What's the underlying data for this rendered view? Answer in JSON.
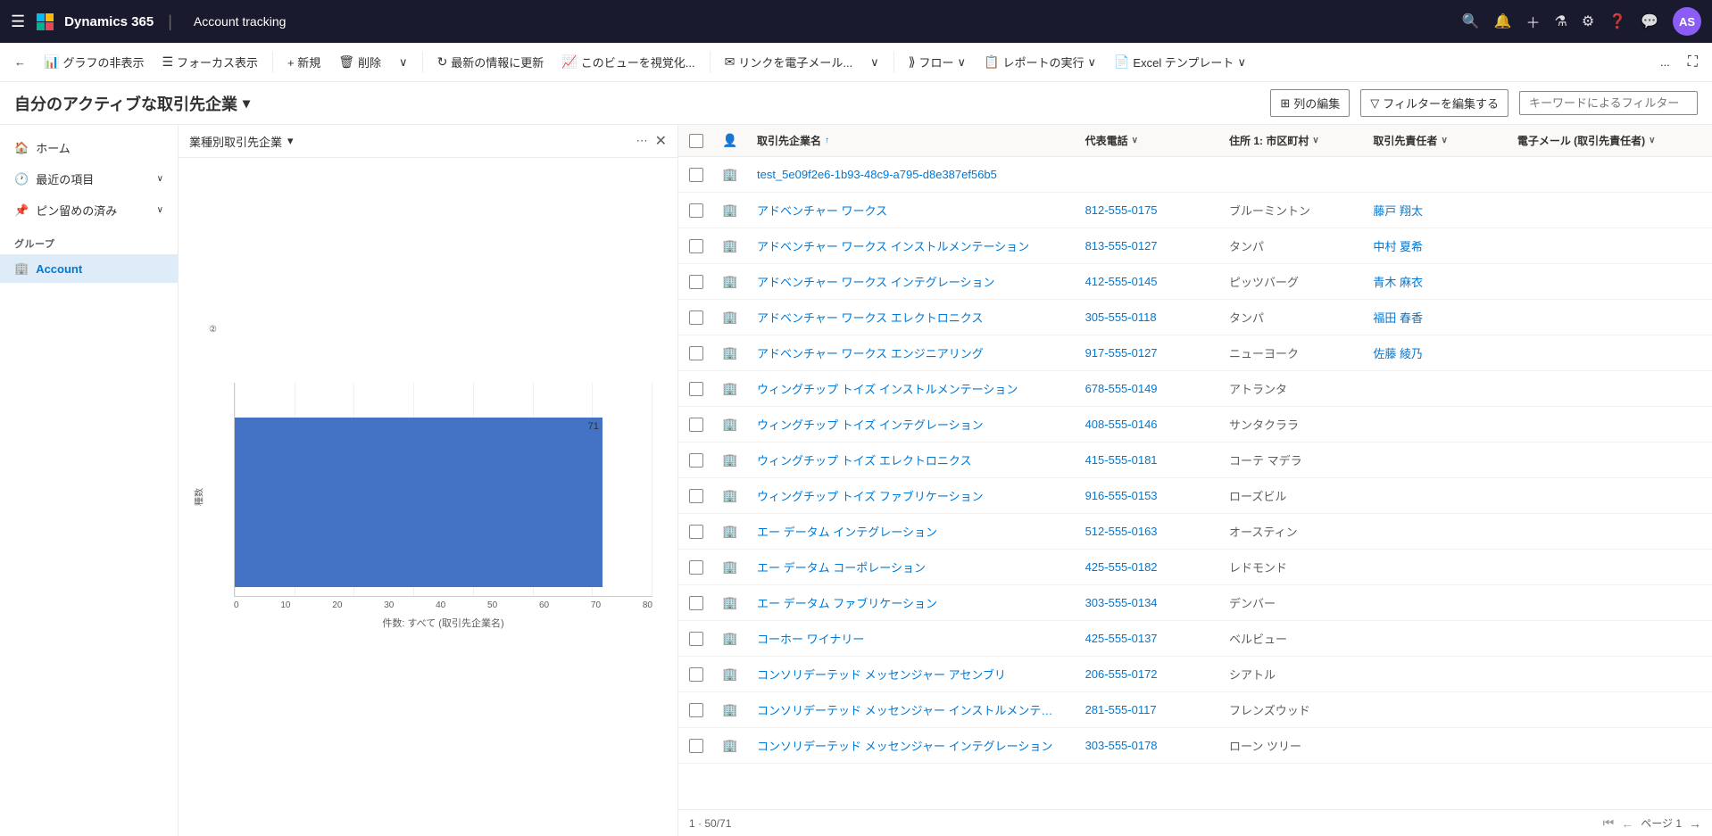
{
  "app": {
    "brand": "Dynamics 365",
    "page_title": "Account tracking"
  },
  "topnav": {
    "icons": [
      "grid-icon",
      "search-icon",
      "alert-icon",
      "plus-icon",
      "filter-icon",
      "settings-icon",
      "help-icon",
      "chat-icon"
    ],
    "avatar_text": "AS"
  },
  "command_bar": {
    "back_label": "←",
    "hide_chart": "グラフの非表示",
    "focus_view": "フォーカス表示",
    "new_label": "+ 新規",
    "delete_label": "削除",
    "refresh_label": "最新の情報に更新",
    "visualize_label": "このビューを視覚化...",
    "email_link": "リンクを電子メール...",
    "flow_label": "フロー",
    "report_label": "レポートの実行",
    "excel_label": "Excel テンプレート",
    "more_label": "..."
  },
  "page_header": {
    "title": "自分のアクティブな取引先企業",
    "dropdown_icon": "▾",
    "edit_columns": "列の編集",
    "edit_filter": "フィルターを編集する",
    "keyword_placeholder": "キーワードによるフィルター"
  },
  "sidebar": {
    "hamburger": "☰",
    "items": [
      {
        "label": "ホーム",
        "icon": "🏠",
        "active": false
      },
      {
        "label": "最近の項目",
        "icon": "🕐",
        "active": false,
        "expand": true
      },
      {
        "label": "ピン留めの済み",
        "icon": "📌",
        "active": false,
        "expand": true
      }
    ],
    "group_label": "グループ",
    "account_label": "Account",
    "account_active": true
  },
  "chart": {
    "title": "業種別取引先企業",
    "dropdown_icon": "▾",
    "bar_value": "71",
    "bar_value_left": "②",
    "x_labels": [
      "0",
      "10",
      "20",
      "30",
      "40",
      "50",
      "60",
      "70",
      "80"
    ],
    "y_label": "種数",
    "x_axis_title": "件数: すべて (取引先企業名)"
  },
  "grid": {
    "columns": [
      {
        "label": "",
        "type": "checkbox"
      },
      {
        "label": "",
        "type": "icon"
      },
      {
        "label": "取引先企業名",
        "sort": "↑",
        "sorted": true
      },
      {
        "label": "代表電話",
        "sort": "∨"
      },
      {
        "label": "住所 1: 市区町村",
        "sort": "∨"
      },
      {
        "label": "取引先責任者",
        "sort": "∨"
      },
      {
        "label": "電子メール (取引先責任者)",
        "sort": "∨"
      }
    ],
    "rows": [
      {
        "name": "test_5e09f2e6-1b93-48c9-a795-d8e387ef56b5",
        "phone": "",
        "city": "",
        "owner": "",
        "email": ""
      },
      {
        "name": "アドベンチャー ワークス",
        "phone": "812-555-0175",
        "city": "ブルーミントン",
        "owner": "藤戸 翔太",
        "email": ""
      },
      {
        "name": "アドベンチャー ワークス インストルメンテーション",
        "phone": "813-555-0127",
        "city": "タンパ",
        "owner": "中村 夏希",
        "email": ""
      },
      {
        "name": "アドベンチャー ワークス インテグレーション",
        "phone": "412-555-0145",
        "city": "ピッツバーグ",
        "owner": "青木 麻衣",
        "email": ""
      },
      {
        "name": "アドベンチャー ワークス エレクトロニクス",
        "phone": "305-555-0118",
        "city": "タンパ",
        "owner": "福田 春香",
        "email": ""
      },
      {
        "name": "アドベンチャー ワークス エンジニアリング",
        "phone": "917-555-0127",
        "city": "ニューヨーク",
        "owner": "佐藤 綾乃",
        "email": ""
      },
      {
        "name": "ウィングチップ トイズ インストルメンテーション",
        "phone": "678-555-0149",
        "city": "アトランタ",
        "owner": "",
        "email": ""
      },
      {
        "name": "ウィングチップ トイズ インテグレーション",
        "phone": "408-555-0146",
        "city": "サンタクララ",
        "owner": "",
        "email": ""
      },
      {
        "name": "ウィングチップ トイズ エレクトロニクス",
        "phone": "415-555-0181",
        "city": "コーテ マデラ",
        "owner": "",
        "email": ""
      },
      {
        "name": "ウィングチップ トイズ ファブリケーション",
        "phone": "916-555-0153",
        "city": "ローズビル",
        "owner": "",
        "email": ""
      },
      {
        "name": "エー データム インテグレーション",
        "phone": "512-555-0163",
        "city": "オースティン",
        "owner": "",
        "email": ""
      },
      {
        "name": "エー データム コーポレーション",
        "phone": "425-555-0182",
        "city": "レドモンド",
        "owner": "",
        "email": ""
      },
      {
        "name": "エー データム ファブリケーション",
        "phone": "303-555-0134",
        "city": "デンバー",
        "owner": "",
        "email": ""
      },
      {
        "name": "コーホー ワイナリー",
        "phone": "425-555-0137",
        "city": "ベルビュー",
        "owner": "",
        "email": ""
      },
      {
        "name": "コンソリデーテッド メッセンジャー アセンブリ",
        "phone": "206-555-0172",
        "city": "シアトル",
        "owner": "",
        "email": ""
      },
      {
        "name": "コンソリデーテッド メッセンジャー インストルメンテーション",
        "phone": "281-555-0117",
        "city": "フレンズウッド",
        "owner": "",
        "email": ""
      },
      {
        "name": "コンソリデーテッド メッセンジャー インテグレーション",
        "phone": "303-555-0178",
        "city": "ローン ツリー",
        "owner": "",
        "email": ""
      }
    ],
    "footer": {
      "count_label": "1 · 50/71",
      "page_label": "ページ 1"
    }
  }
}
